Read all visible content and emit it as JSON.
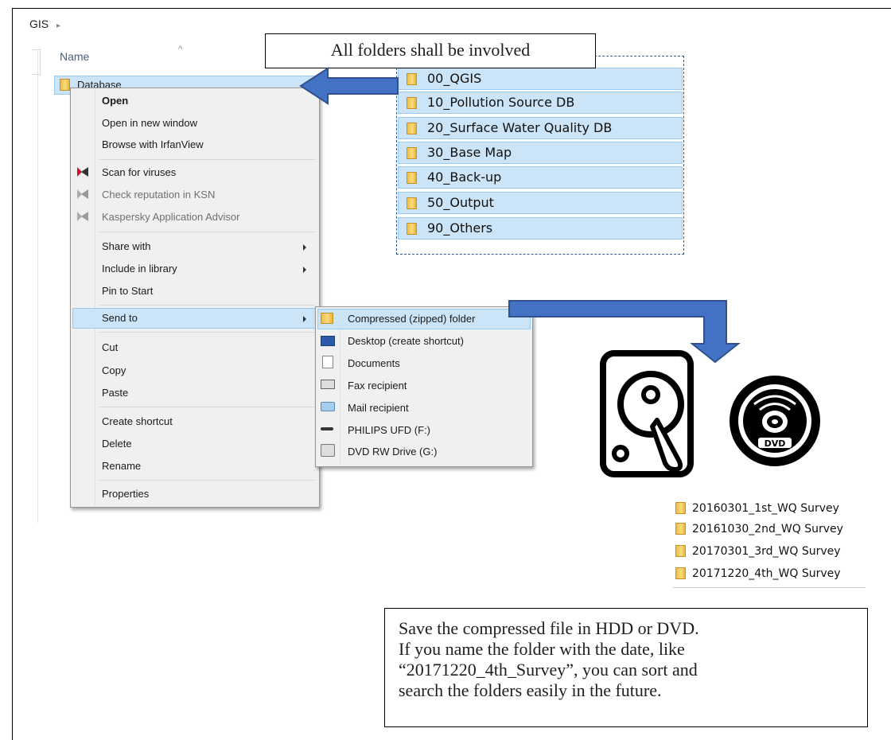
{
  "breadcrumb": {
    "root": "GIS",
    "sep": "▸"
  },
  "header": {
    "name_column": "Name",
    "sort_glyph": "^"
  },
  "selected_item": {
    "label": "Database"
  },
  "callouts": {
    "top": "All folders shall be involved",
    "bottom_lines": [
      "Save the compressed file in HDD or DVD.",
      "If you name the folder with the date, like",
      "“20171220_4th_Survey”, you can sort and",
      "search the folders easily in the future."
    ]
  },
  "context_menu": {
    "open": "Open",
    "open_new_window": "Open in new window",
    "browse_irfanview": "Browse with IrfanView",
    "scan_viruses": "Scan for viruses",
    "check_reputation": "Check reputation in KSN",
    "kaspersky_advisor": "Kaspersky Application Advisor",
    "share_with": "Share with",
    "include_library": "Include in library",
    "pin_start": "Pin to Start",
    "send_to": "Send to",
    "cut": "Cut",
    "copy": "Copy",
    "paste": "Paste",
    "create_shortcut": "Create shortcut",
    "delete": "Delete",
    "rename": "Rename",
    "properties": "Properties"
  },
  "send_to_menu": {
    "zip": "Compressed (zipped) folder",
    "desktop": "Desktop (create shortcut)",
    "documents": "Documents",
    "fax": "Fax recipient",
    "mail": "Mail recipient",
    "usb": "PHILIPS UFD (F:)",
    "dvd": "DVD RW Drive (G:)"
  },
  "database_folders": [
    "00_QGIS",
    "10_Pollution Source DB",
    "20_Surface Water Quality DB",
    "30_Base Map",
    "40_Back-up",
    "50_Output",
    "90_Others"
  ],
  "survey_folders": [
    "20160301_1st_WQ Survey",
    "20161030_2nd_WQ Survey",
    "20170301_3rd_WQ Survey",
    "20171220_4th_WQ Survey"
  ],
  "icons": {
    "hdd": "hard-disk-icon",
    "dvd": "dvd-icon",
    "dvd_label": "DVD"
  },
  "colors": {
    "arrow_blue": "#4472c4",
    "selection": "#cce4f7",
    "menu_bg": "#f0f0f0"
  }
}
